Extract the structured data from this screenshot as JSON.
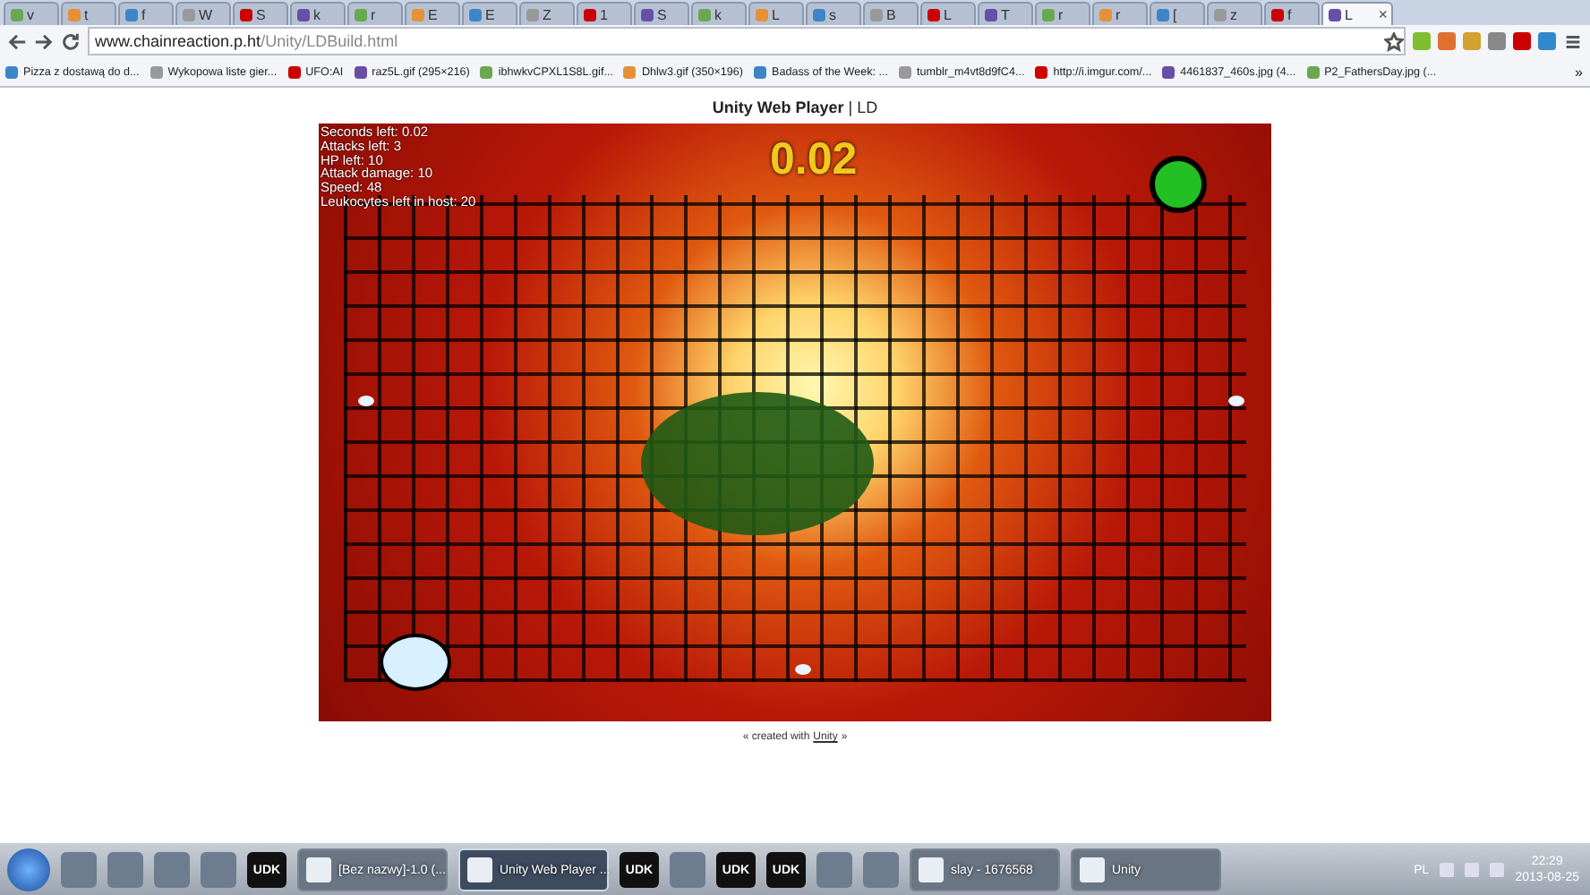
{
  "browser": {
    "tabs": [
      {
        "title": "v",
        "selected": false
      },
      {
        "title": "t",
        "selected": false
      },
      {
        "title": "f",
        "selected": false
      },
      {
        "title": "W",
        "selected": false
      },
      {
        "title": "S",
        "selected": false
      },
      {
        "title": "k",
        "selected": false
      },
      {
        "title": "r",
        "selected": false
      },
      {
        "title": "E",
        "selected": false
      },
      {
        "title": "E",
        "selected": false
      },
      {
        "title": "Z",
        "selected": false
      },
      {
        "title": "1",
        "selected": false
      },
      {
        "title": "S",
        "selected": false
      },
      {
        "title": "k",
        "selected": false
      },
      {
        "title": "L",
        "selected": false
      },
      {
        "title": "s",
        "selected": false
      },
      {
        "title": "B",
        "selected": false
      },
      {
        "title": "L",
        "selected": false
      },
      {
        "title": "T",
        "selected": false
      },
      {
        "title": "r",
        "selected": false
      },
      {
        "title": "r",
        "selected": false
      },
      {
        "title": "[",
        "selected": false
      },
      {
        "title": "z",
        "selected": false
      },
      {
        "title": "f",
        "selected": false
      },
      {
        "title": "L",
        "selected": true
      }
    ],
    "tab_close": "×",
    "address": {
      "host": "www.chainreaction.p.ht",
      "path": "/Unity/LDBuild.html"
    },
    "bookmarks": [
      "Pizza z dostawą do d...",
      "Wykopowa liste gier...",
      "UFO:AI",
      "raz5L.gif (295×216)",
      "ibhwkvCPXL1S8L.gif...",
      "Dhlw3.gif (350×196)",
      "Badass of the Week: ...",
      "tumblr_m4vt8d9fC4...",
      "http://i.imgur.com/...",
      "4461837_460s.jpg (4...",
      "P2_FathersDay.jpg (..."
    ],
    "bookmarks_more": "»"
  },
  "page": {
    "title": "**Unity Web Player** | LD",
    "hud": [
      "Seconds left: 0.02",
      "Attacks left: 3",
      "HP left: 10",
      "Attack damage: 10",
      "Speed: 48",
      "Leukocytes left in host: 20"
    ],
    "timer": "0.02",
    "footer": {
      "before": "« created with",
      "link": "Unity",
      "after": "»"
    }
  },
  "taskbar": {
    "items": [
      {
        "kind": "icon"
      },
      {
        "kind": "icon"
      },
      {
        "kind": "icon"
      },
      {
        "kind": "icon"
      },
      {
        "kind": "udk",
        "label": "UDK"
      },
      {
        "kind": "window",
        "label": "[Bez nazwy]-1.0 (...",
        "selected": false
      },
      {
        "kind": "window",
        "label": "Unity Web Player ...",
        "selected": true
      },
      {
        "kind": "udk",
        "label": "UDK"
      },
      {
        "kind": "icon"
      },
      {
        "kind": "udk",
        "label": "UDK"
      },
      {
        "kind": "udk",
        "label": "UDK"
      },
      {
        "kind": "icon"
      },
      {
        "kind": "icon"
      },
      {
        "kind": "window",
        "label": "slay - 1676568",
        "selected": false
      },
      {
        "kind": "window",
        "label": "Unity",
        "selected": false
      }
    ],
    "language": "PL",
    "time": "22:29",
    "date": "2013-08-25"
  }
}
